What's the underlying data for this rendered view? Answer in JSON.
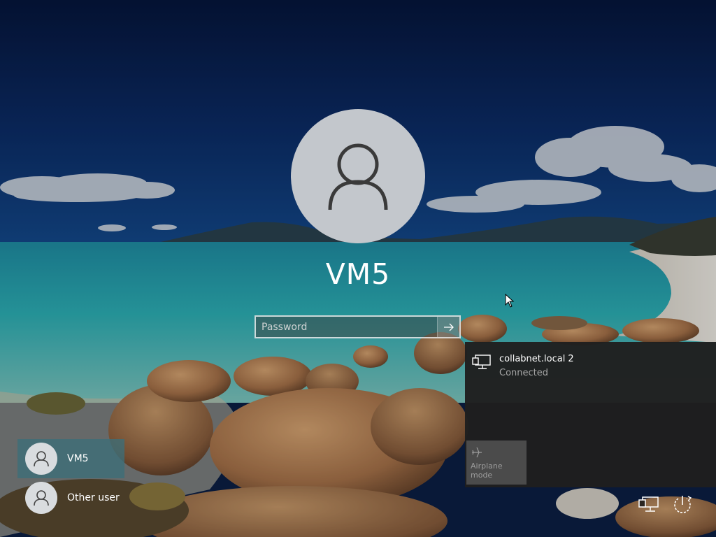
{
  "login": {
    "username": "VM5",
    "password_placeholder": "Password",
    "submit_icon": "arrow-right-icon"
  },
  "users": [
    {
      "label": "VM5",
      "selected": true,
      "icon": "user-icon"
    },
    {
      "label": "Other user",
      "selected": false,
      "icon": "user-icon"
    }
  ],
  "network_flyout": {
    "networks": [
      {
        "name": "collabnet.local 2",
        "status": "Connected",
        "icon": "wired-network-icon"
      }
    ],
    "quick_actions": [
      {
        "label": "Airplane mode",
        "icon": "airplane-icon",
        "enabled": false
      }
    ]
  },
  "system_tray": [
    {
      "name": "network",
      "icon": "wired-network-icon"
    },
    {
      "name": "power",
      "icon": "power-icon"
    }
  ],
  "colors": {
    "selected_user_bg": "#3c6e78",
    "flyout_bg": "#1f1f1f",
    "airplane_tile_bg": "#4b4b4b",
    "avatar_bg": "#c3c7cc"
  }
}
